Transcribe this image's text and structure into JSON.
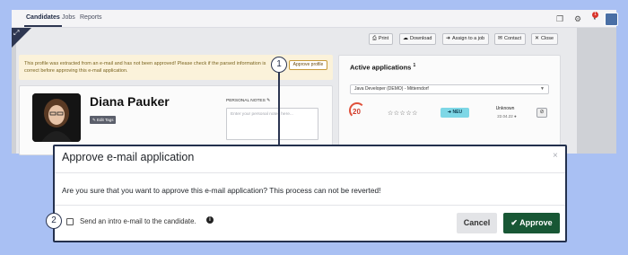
{
  "nav": {
    "tabs": [
      "Candidates",
      "Jobs",
      "Reports"
    ],
    "notification_count": "1",
    "icons": [
      "copy-icon",
      "gear-icon",
      "bell-icon",
      "avatar"
    ]
  },
  "toolbar": {
    "print": "Print",
    "download": "Download",
    "assign": "Assign to a job",
    "contact": "Contact",
    "close": "Close"
  },
  "warning": {
    "text": "This profile was extracted from an e-mail and has not been approved! Please check if the parsed information is correct before approving this e-mail application.",
    "button": "Approve profile"
  },
  "profile": {
    "name": "Diana Pauker",
    "edit_tags": "Edit Tags",
    "notes_label": "PERSONAL NOTES",
    "notes_placeholder": "Enter your personal notes here..."
  },
  "applications": {
    "title": "Active applications",
    "count": "1",
    "selected": "Java Developer (DEMO) - Mitterndorf",
    "score": "20",
    "stars": "☆☆☆☆☆",
    "status": "NEU",
    "stage": "Unknown",
    "date": "22.04.22"
  },
  "callouts": [
    "1",
    "2"
  ],
  "modal": {
    "title": "Approve e-mail application",
    "close": "×",
    "message": "Are you sure that you want to approve this e-mail application? This process can not be reverted!",
    "checkbox_label": "Send an intro e-mail to the candidate.",
    "info": "i",
    "cancel": "Cancel",
    "approve": "Approve",
    "approve_icon": "✔"
  },
  "colors": {
    "primary": "#2d3651",
    "approve": "#185735",
    "warning_bg": "#fbf2da",
    "status_new": "#7ed7e6"
  }
}
